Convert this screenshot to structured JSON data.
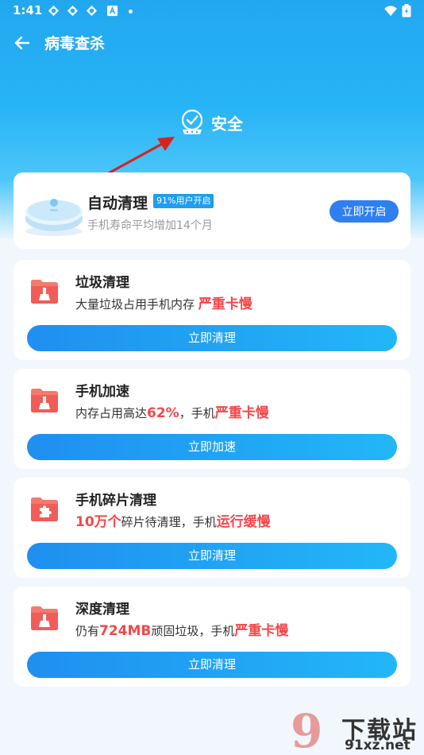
{
  "status_bar": {
    "time": "1:41",
    "icons": [
      "app-icon",
      "app-icon",
      "app-icon",
      "a-icon",
      "dot-icon",
      "wifi-icon",
      "battery-icon"
    ]
  },
  "header": {
    "title": "病毒查杀"
  },
  "hero": {
    "status_text": "安全"
  },
  "auto_clean": {
    "title": "自动清理",
    "badge": "91%用户开启",
    "subtitle": "手机寿命平均增加14个月",
    "button": "立即开启"
  },
  "cards": [
    {
      "title": "垃圾清理",
      "desc_before": "大量垃圾占用手机内存 ",
      "desc_highlight": "严重卡慢",
      "button": "立即清理",
      "icon": "broom-folder-icon"
    },
    {
      "title": "手机加速",
      "desc_before": "内存占用高达",
      "desc_highlight": "62%",
      "desc_mid": "，手机",
      "desc_highlight2": "严重卡慢",
      "button": "立即加速",
      "icon": "broom-folder-icon"
    },
    {
      "title": "手机碎片清理",
      "desc_highlight": "10万个",
      "desc_mid": "碎片待清理，手机",
      "desc_highlight2": "运行缓慢",
      "button": "立即清理",
      "icon": "puzzle-folder-icon"
    },
    {
      "title": "深度清理",
      "desc_before": "仍有",
      "desc_highlight": "724MB",
      "desc_mid": "顽固垃圾，手机",
      "desc_highlight2": "严重卡慢",
      "button": "立即清理",
      "icon": "broom-folder-icon"
    }
  ],
  "watermark": {
    "logo_mark": "9",
    "name": "下载站",
    "url": "91xz.net"
  },
  "colors": {
    "primary": "#2f7ff1",
    "accent_blue": "#22a7ef",
    "highlight_red": "#f4474a",
    "folder_red": "#f25c58"
  }
}
